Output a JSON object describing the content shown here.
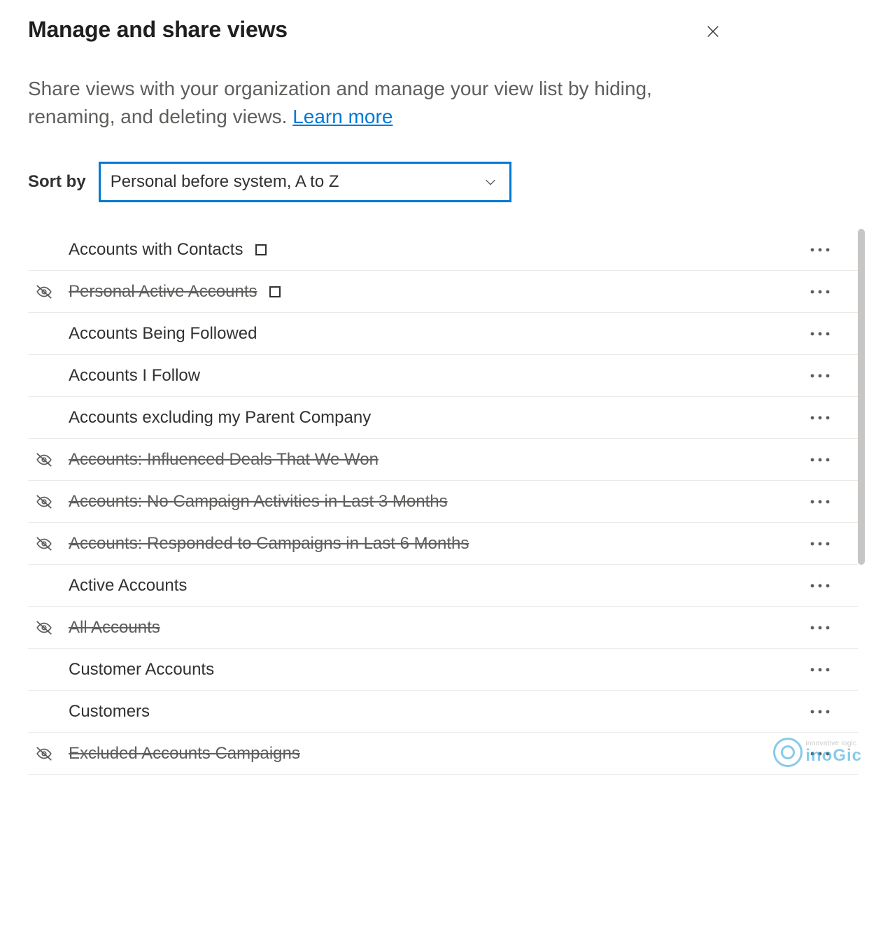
{
  "title": "Manage and share views",
  "description_prefix": "Share views with your organization and manage your view list by hiding, renaming, and deleting views. ",
  "learn_more_label": "Learn more",
  "sort": {
    "label": "Sort by",
    "selected": "Personal before system, A to Z"
  },
  "views": [
    {
      "name": "Accounts with Contacts",
      "hidden": false,
      "personal_badge": true
    },
    {
      "name": "Personal Active Accounts",
      "hidden": true,
      "personal_badge": true
    },
    {
      "name": "Accounts Being Followed",
      "hidden": false,
      "personal_badge": false
    },
    {
      "name": "Accounts I Follow",
      "hidden": false,
      "personal_badge": false
    },
    {
      "name": "Accounts excluding my Parent Company",
      "hidden": false,
      "personal_badge": false
    },
    {
      "name": "Accounts: Influenced Deals That We Won",
      "hidden": true,
      "personal_badge": false
    },
    {
      "name": "Accounts: No Campaign Activities in Last 3 Months",
      "hidden": true,
      "personal_badge": false
    },
    {
      "name": "Accounts: Responded to Campaigns in Last 6 Months",
      "hidden": true,
      "personal_badge": false
    },
    {
      "name": "Active Accounts",
      "hidden": false,
      "personal_badge": false
    },
    {
      "name": "All Accounts",
      "hidden": true,
      "personal_badge": false
    },
    {
      "name": "Customer Accounts",
      "hidden": false,
      "personal_badge": false
    },
    {
      "name": "Customers",
      "hidden": false,
      "personal_badge": false
    },
    {
      "name": "Excluded Accounts Campaigns",
      "hidden": true,
      "personal_badge": false
    }
  ],
  "watermark": {
    "tagline": "innovative logic",
    "brand": "inoGic"
  }
}
